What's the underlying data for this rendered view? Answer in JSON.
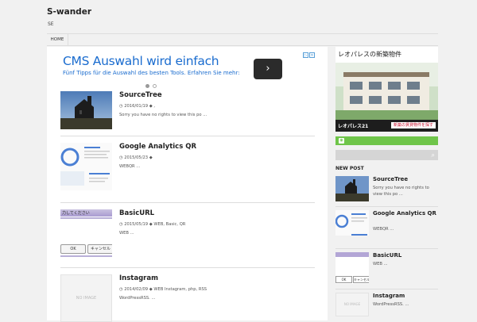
{
  "site": {
    "title": "S-wander",
    "description": "SE"
  },
  "nav": {
    "home": "HOME"
  },
  "ad": {
    "title": "CMS Auswahl wird einfach",
    "subtitle": "Fünf Tipps für die Auswahl des besten Tools. Erfahren Sie mehr:",
    "arrow": "›"
  },
  "posts": [
    {
      "title": "SourceTree",
      "date": "2016/01/19",
      "tags": ",",
      "excerpt": "Sorry you have no rights to view this po ..."
    },
    {
      "title": "Google Analytics QR",
      "date": "2015/05/23",
      "tags": "",
      "excerpt": "WEBQR ..."
    },
    {
      "title": "BasicURL",
      "date": "2015/05/19",
      "tags": "WEB,  Basic, QR",
      "excerpt": "WEB ..."
    },
    {
      "title": "Instagram",
      "date": "2014/02/09",
      "tags": "WEB Instagram, php, RSS",
      "excerpt": "WordPressRSS. ..."
    }
  ],
  "thumbs": {
    "basic_ok": "OK",
    "basic_cancel": "キャンセル",
    "basic_top": "力してください",
    "no_image": "NO IMAGE"
  },
  "sidebar": {
    "ad_text": "レオパレスの新築物件",
    "ad_logo": "レオパレス21",
    "ad_button": "新築の賃貸物件を探す",
    "new_post_heading": "NEW POST",
    "posts": [
      {
        "title": "SourceTree",
        "excerpt": "Sorry you have no rights to view this po ..."
      },
      {
        "title": "Google Analytics QR",
        "excerpt": "WEBQR ..."
      },
      {
        "title": "BasicURL",
        "excerpt": "WEB ..."
      },
      {
        "title": "Instagram",
        "excerpt": "WordPressRSS. ..."
      }
    ]
  }
}
